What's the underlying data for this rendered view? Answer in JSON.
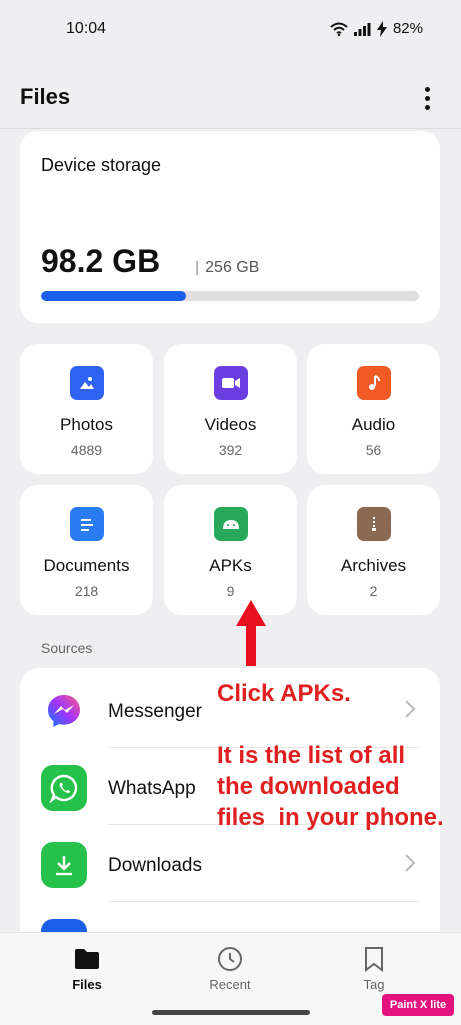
{
  "status_bar": {
    "time": "10:04",
    "battery": "82%"
  },
  "header": {
    "title": "Files"
  },
  "storage": {
    "label": "Device storage",
    "used": "98.2 GB",
    "separator": "|",
    "total": "256 GB",
    "used_fraction": 0.384,
    "accent": "#1a5fe8"
  },
  "categories": [
    {
      "label": "Photos",
      "count": "4889",
      "icon": "image-icon",
      "color": "#2e62f0"
    },
    {
      "label": "Videos",
      "count": "392",
      "icon": "video-icon",
      "color": "#6a3ee0"
    },
    {
      "label": "Audio",
      "count": "56",
      "icon": "music-icon",
      "color": "#f05a24"
    },
    {
      "label": "Documents",
      "count": "218",
      "icon": "document-icon",
      "color": "#2a7cf2"
    },
    {
      "label": "APKs",
      "count": "9",
      "icon": "android-icon",
      "color": "#27a85a"
    },
    {
      "label": "Archives",
      "count": "2",
      "icon": "archive-icon",
      "color": "#8a6a53"
    }
  ],
  "sources": {
    "heading": "Sources",
    "items": [
      {
        "label": "Messenger",
        "icon": "messenger-icon"
      },
      {
        "label": "WhatsApp",
        "icon": "whatsapp-icon"
      },
      {
        "label": "Downloads",
        "icon": "download-icon"
      }
    ]
  },
  "annotation": {
    "line1": "Click APKs.",
    "line2": "It is the list of all",
    "line3": "the downloaded",
    "line4": "files  in your phone.",
    "color": "#e02020"
  },
  "bottom_nav": [
    {
      "label": "Files",
      "icon": "folder-icon",
      "active": true
    },
    {
      "label": "Recent",
      "icon": "clock-icon",
      "active": false
    },
    {
      "label": "Tag",
      "icon": "bookmark-icon",
      "active": false
    }
  ],
  "watermark": "Paint X lite"
}
